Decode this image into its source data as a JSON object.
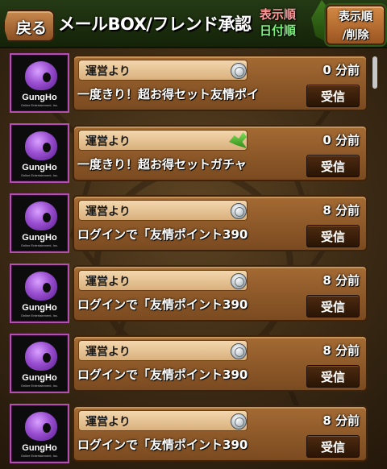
{
  "header": {
    "back_label": "戻る",
    "title": "メールBOX/フレンド承認",
    "sort_label_line1": "表示順",
    "sort_label_line2": "日付順",
    "sort_button_line1": "表示順",
    "sort_button_line2": "/削除"
  },
  "mail_items": [
    {
      "avatar_logo": "GungHo",
      "avatar_sub": "Online Entertainment, Inc.",
      "sender": "運営より",
      "attachment_icon": "coin-icon",
      "time": "0 分前",
      "message": "一度きり！超お得セット友情ポイ",
      "button": "受信"
    },
    {
      "avatar_logo": "GungHo",
      "avatar_sub": "Online Entertainment, Inc.",
      "sender": "運営より",
      "attachment_icon": "dragon-icon",
      "time": "0 分前",
      "message": "一度きり！超お得セットガチャ",
      "button": "受信"
    },
    {
      "avatar_logo": "GungHo",
      "avatar_sub": "Online Entertainment, Inc.",
      "sender": "運営より",
      "attachment_icon": "coin-icon",
      "time": "8 分前",
      "message": "ログインで「友情ポイント390",
      "button": "受信"
    },
    {
      "avatar_logo": "GungHo",
      "avatar_sub": "Online Entertainment, Inc.",
      "sender": "運営より",
      "attachment_icon": "coin-icon",
      "time": "8 分前",
      "message": "ログインで「友情ポイント390",
      "button": "受信"
    },
    {
      "avatar_logo": "GungHo",
      "avatar_sub": "Online Entertainment, Inc.",
      "sender": "運営より",
      "attachment_icon": "coin-icon",
      "time": "8 分前",
      "message": "ログインで「友情ポイント390",
      "button": "受信"
    },
    {
      "avatar_logo": "GungHo",
      "avatar_sub": "Online Entertainment, Inc.",
      "sender": "運営より",
      "attachment_icon": "coin-icon",
      "time": "8 分前",
      "message": "ログインで「友情ポイント390",
      "button": "受信"
    }
  ],
  "colors": {
    "panel_brown": "#a46a33",
    "avatar_border": "#b24fb1",
    "sort_label_red": "#ff9a9a",
    "sort_label_green": "#7df07d"
  }
}
